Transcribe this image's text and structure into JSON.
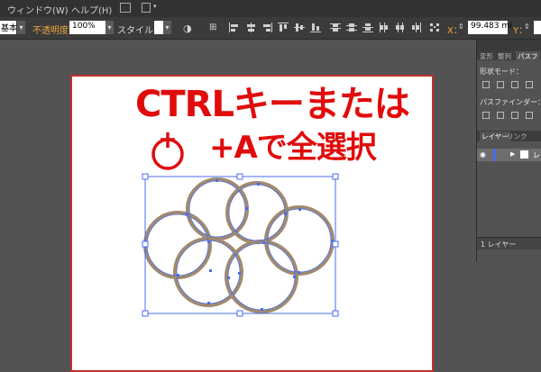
{
  "menubar": {
    "items": [
      "ウィンドウ(W)",
      "ヘルプ(H)"
    ]
  },
  "controlbar": {
    "style_field": "基本",
    "opacity_label": "不透明度：",
    "opacity_value": "100%",
    "style_label": "スタイル：",
    "x_label": "X：",
    "x_value": "99.483 mi",
    "y_label": "Y："
  },
  "overlay": {
    "line1": "CTRLキーまたは",
    "line2": "+Aで全選択"
  },
  "panel": {
    "tabs": [
      "変形",
      "整列",
      "パスフ"
    ],
    "shape_mode_label": "形状モード：",
    "pathfinder_label": "パスファインダー：",
    "layer_tabs": [
      "レイヤー",
      "リンク"
    ],
    "layer_name": "レ",
    "layer_count": "1 レイヤー"
  },
  "colors": {
    "heading": "#e10b0b",
    "artboard_border": "#c3302c",
    "selection": "#4a6cf0",
    "ring": "#9b8467"
  }
}
